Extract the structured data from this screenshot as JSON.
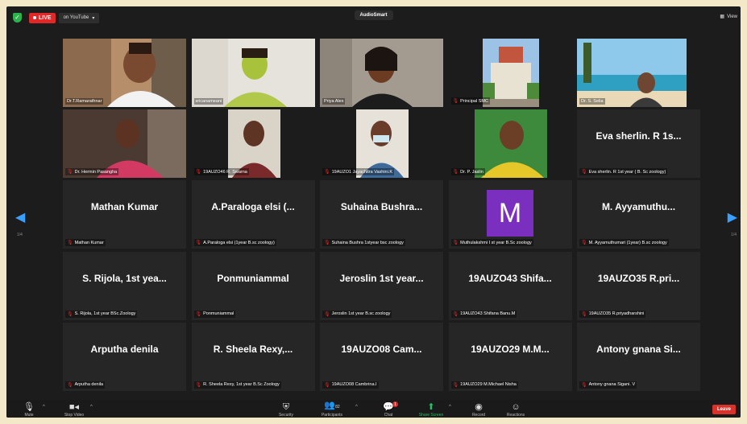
{
  "topbar": {
    "live": "LIVE",
    "stream": "on YouTube",
    "title": "AudioSmart",
    "view": "View"
  },
  "pager": {
    "left": "1/4",
    "right": "1/4"
  },
  "tiles": [
    {
      "big": "",
      "label": "Dr.T.Ramarathnar",
      "muted": false
    },
    {
      "big": "",
      "label": "sricanameani",
      "muted": false
    },
    {
      "big": "",
      "label": "Priya Alex",
      "muted": false
    },
    {
      "big": "",
      "label": "Principal SMC",
      "muted": true
    },
    {
      "big": "",
      "label": "Dr. S. Selia",
      "muted": false
    },
    {
      "big": "",
      "label": "Dr. Hermin Pasangha",
      "muted": true
    },
    {
      "big": "",
      "label": "19AUZO46 R. Swarna",
      "muted": true
    },
    {
      "big": "",
      "label": "19AUZO1 Jayachitra Vashini.K",
      "muted": true
    },
    {
      "big": "",
      "label": "Dr. P. Jaslin",
      "muted": true
    },
    {
      "big": "Eva sherlin. R 1s...",
      "label": "Eva sherlin. R 1st year ( B. Sc zoology)",
      "muted": true
    },
    {
      "big": "Mathan Kumar",
      "label": "Mathan Kumar",
      "muted": true
    },
    {
      "big": "A.Paraloga elsi (...",
      "label": "A.Paraloga elsi (1year B.sc zoology)",
      "muted": true
    },
    {
      "big": "Suhaina Bushra...",
      "label": "Suhaina Bushra 1styear bsc zoology",
      "muted": true
    },
    {
      "big": "M",
      "label": "Muthulakshmi I st year B.Sc zoology",
      "muted": true
    },
    {
      "big": "M. Ayyamuthu...",
      "label": "M. Ayyamuthumari (1year) B.sc zoology",
      "muted": true
    },
    {
      "big": "S. Rijola, 1st yea...",
      "label": "S. Rijola, 1st year BSc.Zoology",
      "muted": true
    },
    {
      "big": "Ponmuniammal",
      "label": "Ponmuniammal",
      "muted": true
    },
    {
      "big": "Jeroslin 1st year...",
      "label": "Jeroslin 1st year B.sc zoology",
      "muted": true
    },
    {
      "big": "19AUZO43 Shifa...",
      "label": "19AUZO43 Shifana Banu.M",
      "muted": true
    },
    {
      "big": "19AUZO35 R.pri...",
      "label": "19AUZO35 R.priyadharshini",
      "muted": true
    },
    {
      "big": "Arputha denila",
      "label": "Arputha denila",
      "muted": true
    },
    {
      "big": "R. Sheela Rexy,...",
      "label": "R. Sheela Rexy, 1st year B.Sc Zoology",
      "muted": true
    },
    {
      "big": "19AUZO08 Cam...",
      "label": "19AUZO08 Cambrina.I",
      "muted": true
    },
    {
      "big": "19AUZO29 M.M...",
      "label": "19AUZO29 M.Michael Nisha",
      "muted": true
    },
    {
      "big": "Antony gnana Si...",
      "label": "Antony gnana Sigani. V",
      "muted": true
    }
  ],
  "toolbar": {
    "mute": "Mute",
    "stop_video": "Stop Video",
    "security": "Security",
    "participants": "Participants",
    "participants_count": "82",
    "chat": "Chat",
    "chat_badge": "1",
    "share_screen": "Share Screen",
    "record": "Record",
    "reactions": "Reactions",
    "leave": "Leave"
  },
  "colors": {
    "accent_green": "#24c064",
    "live_red": "#e02828",
    "leave_red": "#d9322b",
    "active_outline": "#c7e070",
    "avatar_purple": "#7b2fbf",
    "pager_blue": "#3aa0ff"
  }
}
